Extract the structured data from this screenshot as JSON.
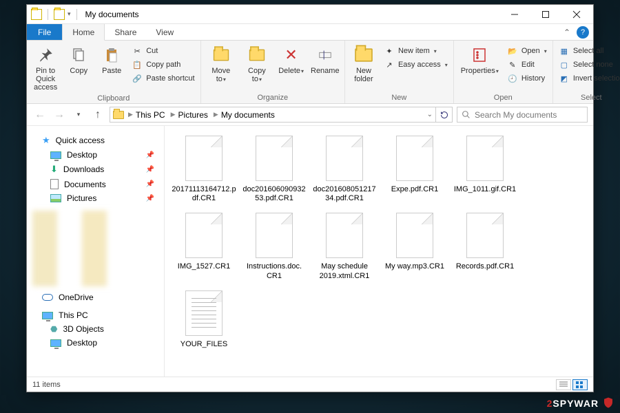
{
  "window": {
    "title": "My documents"
  },
  "tabs": {
    "file": "File",
    "home": "Home",
    "share": "Share",
    "view": "View"
  },
  "ribbon": {
    "clipboard": {
      "label": "Clipboard",
      "pin": "Pin to Quick access",
      "copy": "Copy",
      "paste": "Paste",
      "cut": "Cut",
      "copy_path": "Copy path",
      "paste_shortcut": "Paste shortcut"
    },
    "organize": {
      "label": "Organize",
      "move_to": "Move to",
      "copy_to": "Copy to",
      "delete": "Delete",
      "rename": "Rename"
    },
    "new": {
      "label": "New",
      "new_folder": "New folder",
      "new_item": "New item",
      "easy_access": "Easy access"
    },
    "open": {
      "label": "Open",
      "properties": "Properties",
      "open": "Open",
      "edit": "Edit",
      "history": "History"
    },
    "select": {
      "label": "Select",
      "select_all": "Select all",
      "select_none": "Select none",
      "invert": "Invert selection"
    }
  },
  "breadcrumb": {
    "a": "This PC",
    "b": "Pictures",
    "c": "My documents"
  },
  "search": {
    "placeholder": "Search My documents"
  },
  "sidebar": {
    "quick_access": "Quick access",
    "items": [
      {
        "label": "Desktop"
      },
      {
        "label": "Downloads"
      },
      {
        "label": "Documents"
      },
      {
        "label": "Pictures"
      }
    ],
    "onedrive": "OneDrive",
    "this_pc": "This PC",
    "tp_items": [
      {
        "label": "3D Objects"
      },
      {
        "label": "Desktop"
      }
    ]
  },
  "files": [
    {
      "name": "20171113164712.pdf.CR1",
      "type": "blank"
    },
    {
      "name": "doc201606090932 53.pdf.CR1",
      "type": "blank"
    },
    {
      "name": "doc201608051217 34.pdf.CR1",
      "type": "blank"
    },
    {
      "name": "Expe.pdf.CR1",
      "type": "blank"
    },
    {
      "name": "IMG_1011.gif.CR1",
      "type": "blank"
    },
    {
      "name": "IMG_1527.CR1",
      "type": "blank"
    },
    {
      "name": "Instructions.doc. CR1",
      "type": "blank"
    },
    {
      "name": "May schedule 2019.xtml.CR1",
      "type": "blank"
    },
    {
      "name": "My way.mp3.CR1",
      "type": "blank"
    },
    {
      "name": "Records.pdf.CR1",
      "type": "blank"
    },
    {
      "name": "YOUR_FILES",
      "type": "text"
    }
  ],
  "status": {
    "count": "11 items"
  },
  "watermark": {
    "a": "2",
    "b": "SPYWAR"
  }
}
